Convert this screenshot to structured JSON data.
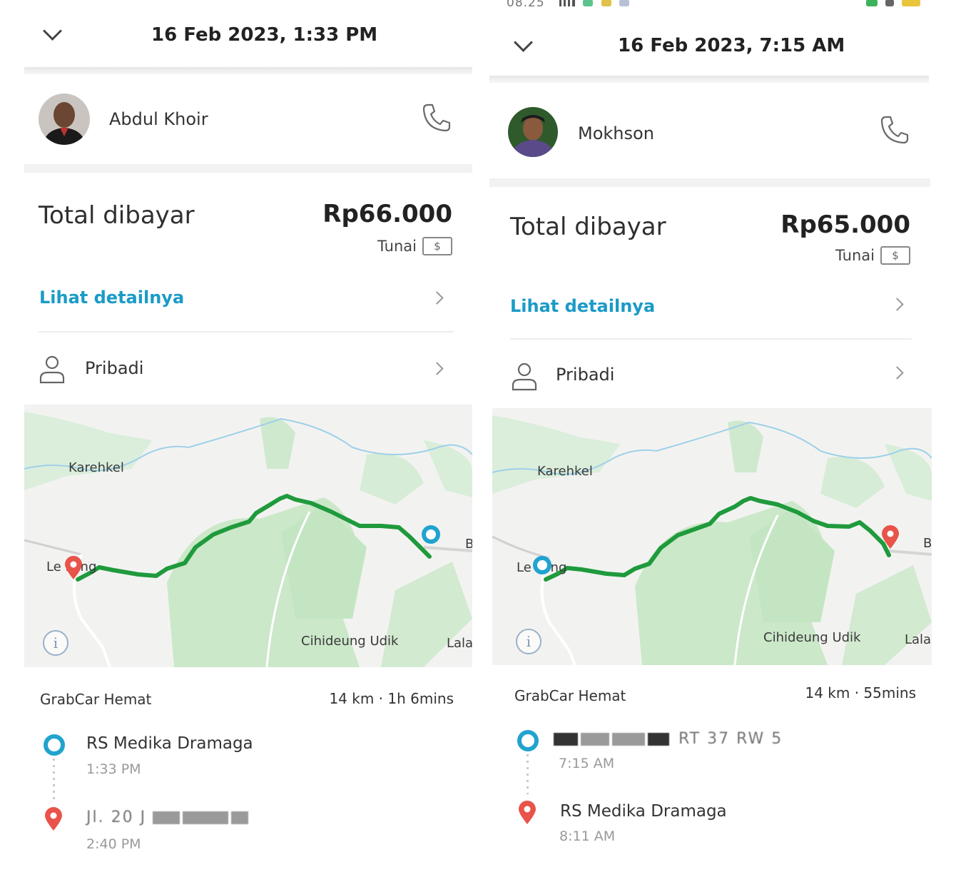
{
  "status_bar": {
    "time": "08.25"
  },
  "left": {
    "title": "16 Feb 2023, 1:33 PM",
    "driver_name": "Abdul Khoir",
    "total_label": "Total dibayar",
    "amount": "Rp66.000",
    "payment_method": "Tunai",
    "cash_symbol": "$",
    "detail_link": "Lihat detailnya",
    "profile": "Pribadi",
    "map_labels": {
      "karehkel": "Karehkel",
      "leuwiliang": "Le liang",
      "cihideung": "Cihideung Udik",
      "lala": "Lala",
      "b": "B"
    },
    "service": "GrabCar Hemat",
    "trip_meta": "14 km · 1h 6mins",
    "pickup_name": "RS Medika Dramaga",
    "pickup_time": "1:33 PM",
    "dropoff_name": "Jl. 20 J",
    "dropoff_time": "2:40 PM"
  },
  "right": {
    "title": "16 Feb 2023, 7:15 AM",
    "driver_name": "Mokhson",
    "total_label": "Total dibayar",
    "amount": "Rp65.000",
    "payment_method": "Tunai",
    "cash_symbol": "$",
    "detail_link": "Lihat detailnya",
    "profile": "Pribadi",
    "map_labels": {
      "karehkel": "Karehkel",
      "leuwiliang": "Le liang",
      "cihideung": "Cihideung Udik",
      "lala": "Lala",
      "b": "B"
    },
    "service": "GrabCar Hemat",
    "trip_meta": "14 km · 55mins",
    "pickup_name": "RT 37 RW 5",
    "pickup_time": "7:15 AM",
    "dropoff_name": "RS Medika Dramaga",
    "dropoff_time": "8:11 AM"
  },
  "colors": {
    "route": "#1f9a3c",
    "pickup": "#21a3cf",
    "dropoff": "#e8534a",
    "link": "#1a9bc7"
  }
}
